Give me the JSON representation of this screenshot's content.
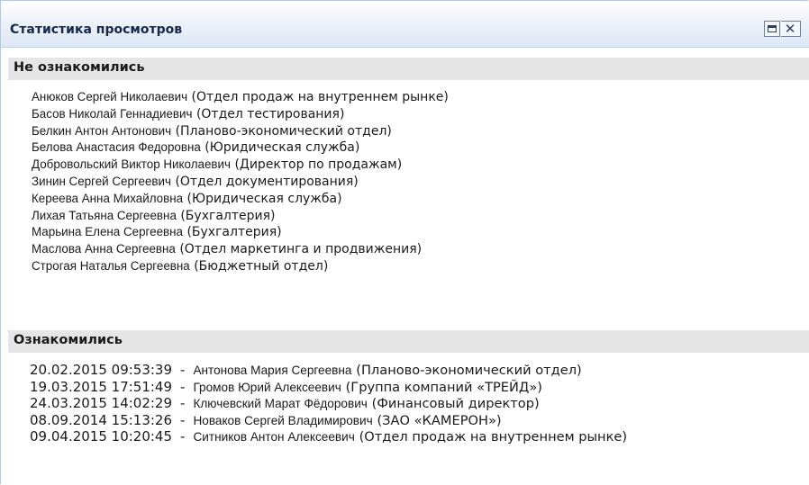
{
  "window": {
    "title": "Статистика просмотров",
    "maximize_icon": "maximize-icon",
    "close_icon": "close-icon"
  },
  "not_read": {
    "header": "Не ознакомились",
    "items": [
      {
        "name": "Анюков Сергей Николаевич",
        "dept": "(Отдел продаж на внутреннем рынке)"
      },
      {
        "name": "Басов Николай Геннадиевич",
        "dept": "(Отдел тестирования)"
      },
      {
        "name": "Белкин Антон Антонович",
        "dept": "(Планово-экономический отдел)"
      },
      {
        "name": "Белова Анастасия Федоровна",
        "dept": "(Юридическая служба)"
      },
      {
        "name": "Добровольский Виктор Николаевич",
        "dept": "(Директор по продажам)"
      },
      {
        "name": "Зинин Сергей Сергеевич",
        "dept": "(Отдел документирования)"
      },
      {
        "name": "Кереева Анна Михайловна",
        "dept": "(Юридическая служба)"
      },
      {
        "name": "Лихая Татьяна Сергеевна",
        "dept": "(Бухгалтерия)"
      },
      {
        "name": "Марьина Елена Сергеевна",
        "dept": "(Бухгалтерия)"
      },
      {
        "name": "Маслова Анна Сергеевна",
        "dept": "(Отдел маркетинга и продвижения)"
      },
      {
        "name": "Строгая Наталья Сергеевна",
        "dept": "(Бюджетный отдел)"
      }
    ]
  },
  "read": {
    "header": "Ознакомились",
    "separator": "-",
    "items": [
      {
        "timestamp": "20.02.2015 09:53:39",
        "name": "Антонова Мария Сергеевна",
        "dept": "(Планово-экономический отдел)"
      },
      {
        "timestamp": "19.03.2015 17:51:49",
        "name": "Громов Юрий Алексеевич",
        "dept": "(Группа компаний «ТРЕЙД»)"
      },
      {
        "timestamp": "24.03.2015 14:02:29",
        "name": "Ключевский Марат Фёдорович",
        "dept": "(Финансовый директор)"
      },
      {
        "timestamp": "08.09.2014 15:13:26",
        "name": "Новаков Сергей Владимирович",
        "dept": "(ЗАО «КАМЕРОН»)"
      },
      {
        "timestamp": "09.04.2015 10:20:45",
        "name": "Ситников Антон Алексеевич",
        "dept": "(Отдел продаж на внутреннем рынке)"
      }
    ]
  }
}
